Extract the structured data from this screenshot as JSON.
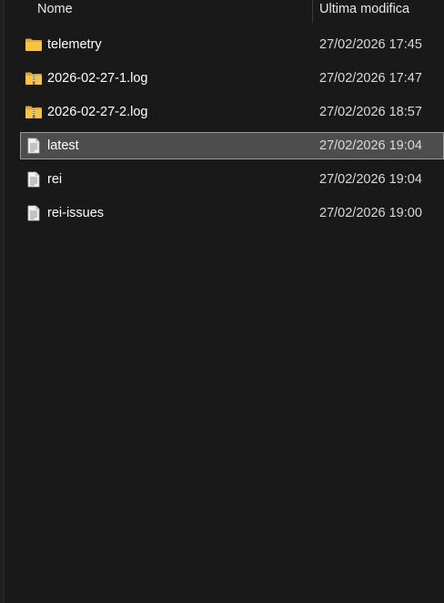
{
  "columns": {
    "name_label": "Nome",
    "date_label": "Ultima modifica"
  },
  "files": [
    {
      "name": "telemetry",
      "modified": "27/02/2026 17:45",
      "icon": "folder-icon",
      "selected": false
    },
    {
      "name": "2026-02-27-1.log",
      "modified": "27/02/2026 17:47",
      "icon": "zip-folder-icon",
      "selected": false
    },
    {
      "name": "2026-02-27-2.log",
      "modified": "27/02/2026 18:57",
      "icon": "zip-folder-icon",
      "selected": false
    },
    {
      "name": "latest",
      "modified": "27/02/2026 19:04",
      "icon": "text-file-icon",
      "selected": true
    },
    {
      "name": "rei",
      "modified": "27/02/2026 19:04",
      "icon": "text-file-icon",
      "selected": false
    },
    {
      "name": "rei-issues",
      "modified": "27/02/2026 19:00",
      "icon": "text-file-icon",
      "selected": false
    }
  ],
  "colors": {
    "background": "#191919",
    "selection_fill": "#4d4d4d",
    "selection_border": "#999999",
    "folder": "#f6c342",
    "file": "#f2f2f2"
  }
}
